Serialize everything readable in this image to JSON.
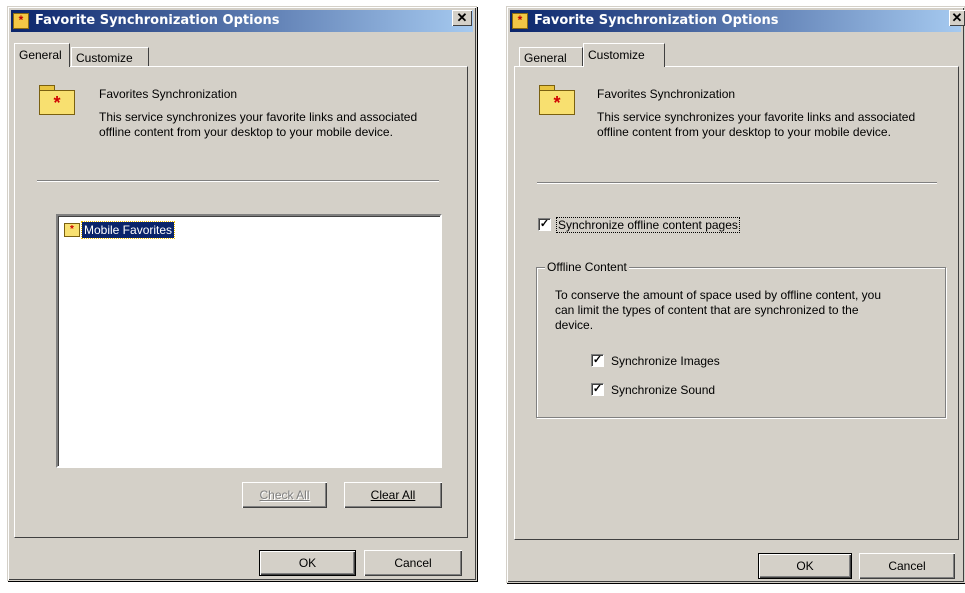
{
  "dialog_general": {
    "title": "Favorite Synchronization Options",
    "close_glyph": "✕",
    "tabs": [
      "General",
      "Customize"
    ],
    "active_tab": "General",
    "section_title": "Favorites Synchronization",
    "description": "This service synchronizes your favorite links and associated offline content from your desktop to your mobile device.",
    "tree_items": [
      "Mobile Favorites"
    ],
    "check_all_label": "Check All",
    "clear_all_label": "Clear All",
    "ok_label": "OK",
    "cancel_label": "Cancel"
  },
  "dialog_customize": {
    "title": "Favorite Synchronization Options",
    "close_glyph": "✕",
    "tabs": [
      "General",
      "Customize"
    ],
    "active_tab": "Customize",
    "section_title": "Favorites Synchronization",
    "description": "This service synchronizes your favorite links and associated offline content from your desktop to your mobile device.",
    "sync_offline_label": "Synchronize offline content pages",
    "sync_offline_checked": true,
    "offline_group_label": "Offline Content",
    "offline_group_text": "To conserve the amount of space used by offline content, you can limit the types of content that are synchronized to the device.",
    "sync_images_label": "Synchronize Images",
    "sync_images_checked": true,
    "sync_sound_label": "Synchronize Sound",
    "sync_sound_checked": true,
    "ok_label": "OK",
    "cancel_label": "Cancel"
  },
  "colors": {
    "face": "#d4d0c8",
    "titlebar_start": "#0a246a",
    "titlebar_end": "#a6caf0",
    "selection": "#0a246a"
  },
  "icons": [
    "folder-star-icon",
    "close-icon",
    "checkmark-icon"
  ]
}
